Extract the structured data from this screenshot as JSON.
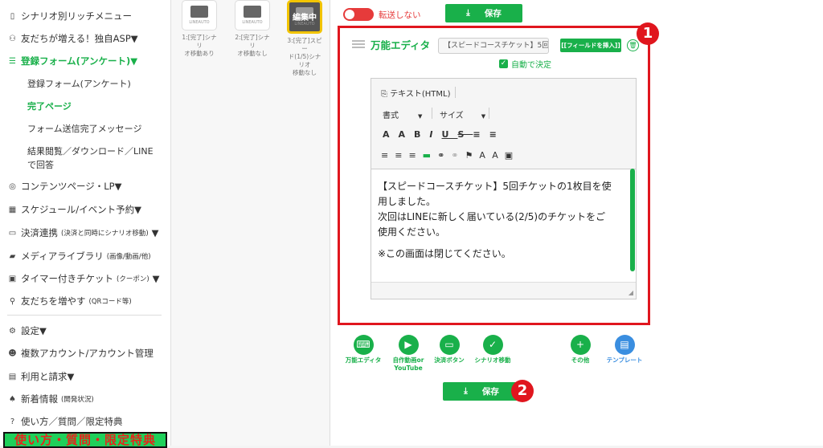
{
  "sidebar": {
    "items": [
      {
        "label": "シナリオ別リッチメニュー",
        "icon": "phone-icon"
      },
      {
        "label": "友だちが増える！独自ASP▼",
        "icon": "handshake-icon"
      },
      {
        "label": "登録フォーム(アンケート)▼",
        "icon": "list-icon"
      },
      {
        "label": "コンテンツページ・LP▼",
        "icon": "globe-icon"
      },
      {
        "label": "スケジュール/イベント予約▼",
        "icon": "calendar-icon"
      },
      {
        "label": "決済連携",
        "small": "(決済と同時にシナリオ移動)",
        "tail": "▼",
        "icon": "card-icon"
      },
      {
        "label": "メディアライブラリ",
        "small": "(画像/動画/他)",
        "icon": "folder-icon"
      },
      {
        "label": "タイマー付きチケット",
        "small": "(クーポン)",
        "tail": "▼",
        "icon": "ticket-icon"
      },
      {
        "label": "友だちを増やす",
        "small": "(QRコード等)",
        "icon": "user-plus-icon"
      },
      {
        "label": "設定▼",
        "icon": "gear-icon"
      },
      {
        "label": "複数アカウント/アカウント管理",
        "icon": "users-icon"
      },
      {
        "label": "利用と請求▼",
        "icon": "bill-icon"
      },
      {
        "label": "新着情報",
        "small": "(開発状況)",
        "icon": "bell-icon"
      },
      {
        "label": "使い方／質問／限定特典",
        "icon": "question-icon"
      }
    ],
    "subitems": [
      "登録フォーム(アンケート)",
      "完了ページ",
      "フォーム送信完了メッセージ",
      "結果閲覧／ダウンロード／LINE",
      "で回答"
    ],
    "banner": "使い方・質問・限定特典"
  },
  "thumbs": [
    {
      "caption1": "1:[完了]シナリ",
      "caption2": "オ移動あり",
      "logo": "LINEAUTO"
    },
    {
      "caption1": "2:[完了]シナリ",
      "caption2": "オ移動なし",
      "logo": "LINEAUTO"
    },
    {
      "caption1": "3:[完了]スピー",
      "caption2": "ド(1/5)シナリオ",
      "caption3": "移動なし",
      "logo": "LINEAUTO",
      "badge": "編集中"
    }
  ],
  "top": {
    "toggle_label": "転送しない",
    "save": "保存"
  },
  "editor": {
    "title": "万能エディタ",
    "select": "【スピードコースチケット】5回",
    "insert": "[[フィールドを挿入]]",
    "auto": "自動で決定",
    "tab": "テキスト(HTML)",
    "format": "書式",
    "size": "サイズ",
    "lines": [
      "【スピードコースチケット】5回チケットの1枚目を使",
      "用しました。",
      "次回はLINEに新しく届いている(2/5)のチケットをご",
      "使用ください。",
      "※この画面は閉じてください。"
    ]
  },
  "actions": [
    {
      "label": "万能エディタ",
      "icon": "keyboard-icon"
    },
    {
      "label": "自作動画or YouTube",
      "icon": "youtube-icon"
    },
    {
      "label": "決済ボタン",
      "icon": "card-icon"
    },
    {
      "label": "シナリオ移動",
      "icon": "check-icon"
    },
    {
      "label": "その他",
      "icon": "plus-icon"
    },
    {
      "label": "テンプレート",
      "icon": "template-icon"
    }
  ],
  "bottom_save": "保存",
  "markers": [
    "1",
    "2"
  ],
  "colors": {
    "accent": "#19b04a",
    "red": "#e0161e"
  }
}
